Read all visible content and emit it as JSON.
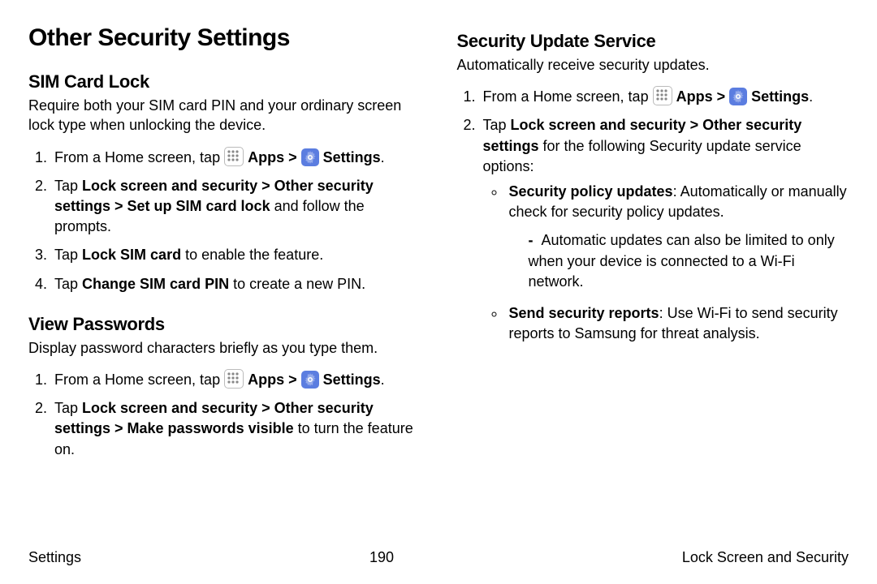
{
  "page": {
    "title": "Other Security Settings"
  },
  "left": {
    "sim": {
      "heading": "SIM Card Lock",
      "intro": "Require both your SIM card PIN and your ordinary screen lock type when unlocking the device.",
      "step1_a": "From a Home screen, tap ",
      "step1_b": "Apps",
      "step1_c": "Settings",
      "step2_a": "Tap ",
      "step2_b": "Lock screen and security",
      "step2_c": "Other security settings",
      "step2_d": "Set up SIM card lock",
      "step2_e": " and follow the prompts.",
      "step3_a": "Tap ",
      "step3_b": "Lock SIM card",
      "step3_c": " to enable the feature.",
      "step4_a": "Tap ",
      "step4_b": "Change SIM card PIN",
      "step4_c": " to create a new PIN."
    },
    "view": {
      "heading": "View Passwords",
      "intro": "Display password characters briefly as you type them.",
      "step1_a": "From a Home screen, tap ",
      "step1_b": "Apps",
      "step1_c": "Settings",
      "step2_a": "Tap ",
      "step2_b": "Lock screen and security",
      "step2_c": "Other security settings",
      "step2_d": "Make passwords visible",
      "step2_e": " to turn the feature on."
    }
  },
  "right": {
    "sus": {
      "heading": "Security Update Service",
      "intro": "Automatically receive security updates.",
      "step1_a": "From a Home screen, tap ",
      "step1_b": "Apps",
      "step1_c": "Settings",
      "step2_a": "Tap ",
      "step2_b": "Lock screen and security",
      "step2_c": "Other security settings",
      "step2_d": " for the following Security update service options:",
      "bullet1_a": "Security policy updates",
      "bullet1_b": ": Automatically or manually check for security policy updates.",
      "bullet1_sub": "Automatic updates can also be limited to only when your device is connected to a Wi‑Fi network.",
      "bullet2_a": "Send security reports",
      "bullet2_b": ": Use Wi‑Fi to send security reports to Samsung for threat analysis."
    }
  },
  "footer": {
    "left": "Settings",
    "center": "190",
    "right": "Lock Screen and Security"
  },
  "tokens": {
    "dot": ".",
    "chev": " > "
  }
}
